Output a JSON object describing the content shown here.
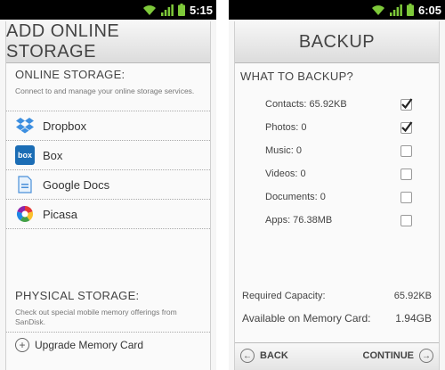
{
  "left": {
    "status": {
      "time": "5:15"
    },
    "title": "ADD ONLINE STORAGE",
    "online": {
      "heading": "ONLINE STORAGE:",
      "description": "Connect to and manage your online storage services.",
      "services": [
        {
          "label": "Dropbox",
          "icon": "dropbox-icon"
        },
        {
          "label": "Box",
          "icon": "box-icon",
          "icon_text": "box"
        },
        {
          "label": "Google Docs",
          "icon": "google-docs-icon"
        },
        {
          "label": "Picasa",
          "icon": "picasa-icon"
        }
      ]
    },
    "physical": {
      "heading": "PHYSICAL STORAGE:",
      "description": "Check out special mobile memory offerings from SanDisk.",
      "upgrade_label": "Upgrade Memory Card"
    }
  },
  "right": {
    "status": {
      "time": "6:05"
    },
    "title": "BACKUP",
    "heading": "WHAT TO BACKUP?",
    "items": [
      {
        "label": "Contacts: 65.92KB",
        "checked": true
      },
      {
        "label": "Photos: 0",
        "checked": true
      },
      {
        "label": "Music: 0",
        "checked": false
      },
      {
        "label": "Videos: 0",
        "checked": false
      },
      {
        "label": "Documents: 0",
        "checked": false
      },
      {
        "label": "Apps: 76.38MB",
        "checked": false
      }
    ],
    "required_label": "Required Capacity:",
    "required_value": "65.92KB",
    "available_label": "Available on Memory Card:",
    "available_value": "1.94GB",
    "back_label": "BACK",
    "continue_label": "CONTINUE"
  },
  "colors": {
    "status_bar": "#000000",
    "signal_green": "#7ec93a",
    "dropbox_blue": "#3d8fe0",
    "box_blue": "#1b6db5"
  }
}
